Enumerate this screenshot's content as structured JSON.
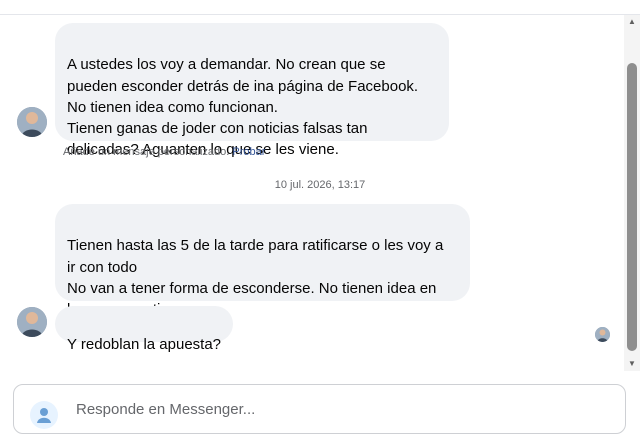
{
  "messages": [
    {
      "text": "A ustedes los voy a demandar.  No crean que se\npueden esconder detrás de ina página de Facebook.\nNo tienen idea como funcionan.\nTienen ganas de joder con noticias falsas tan\ndelicadas?   Aguanten lo que se les viene."
    },
    {
      "text": "Tienen hasta las 5 de la tarde para ratificarse o les voy a\nir con todo\nNo van a tener forma de esconderse.  No tienen idea en\nla que se.metieron"
    },
    {
      "text": "Y redoblan la apuesta?"
    }
  ],
  "hint": {
    "text": "Añade un mensaje personalizado.",
    "link": "Probar"
  },
  "timestamp": "10 jul. 2026, 13:17",
  "composer": {
    "placeholder": "Responde en Messenger..."
  },
  "icons": {
    "avatar": "user-avatar-icon",
    "seen": "seen-avatar-icon",
    "composer": "messenger-icon",
    "scroll_up": "scroll-up-arrow-icon",
    "scroll_down": "scroll-down-arrow-icon"
  },
  "colors": {
    "bubble": "#f0f2f5",
    "link": "#385898",
    "muted": "#65676b"
  }
}
